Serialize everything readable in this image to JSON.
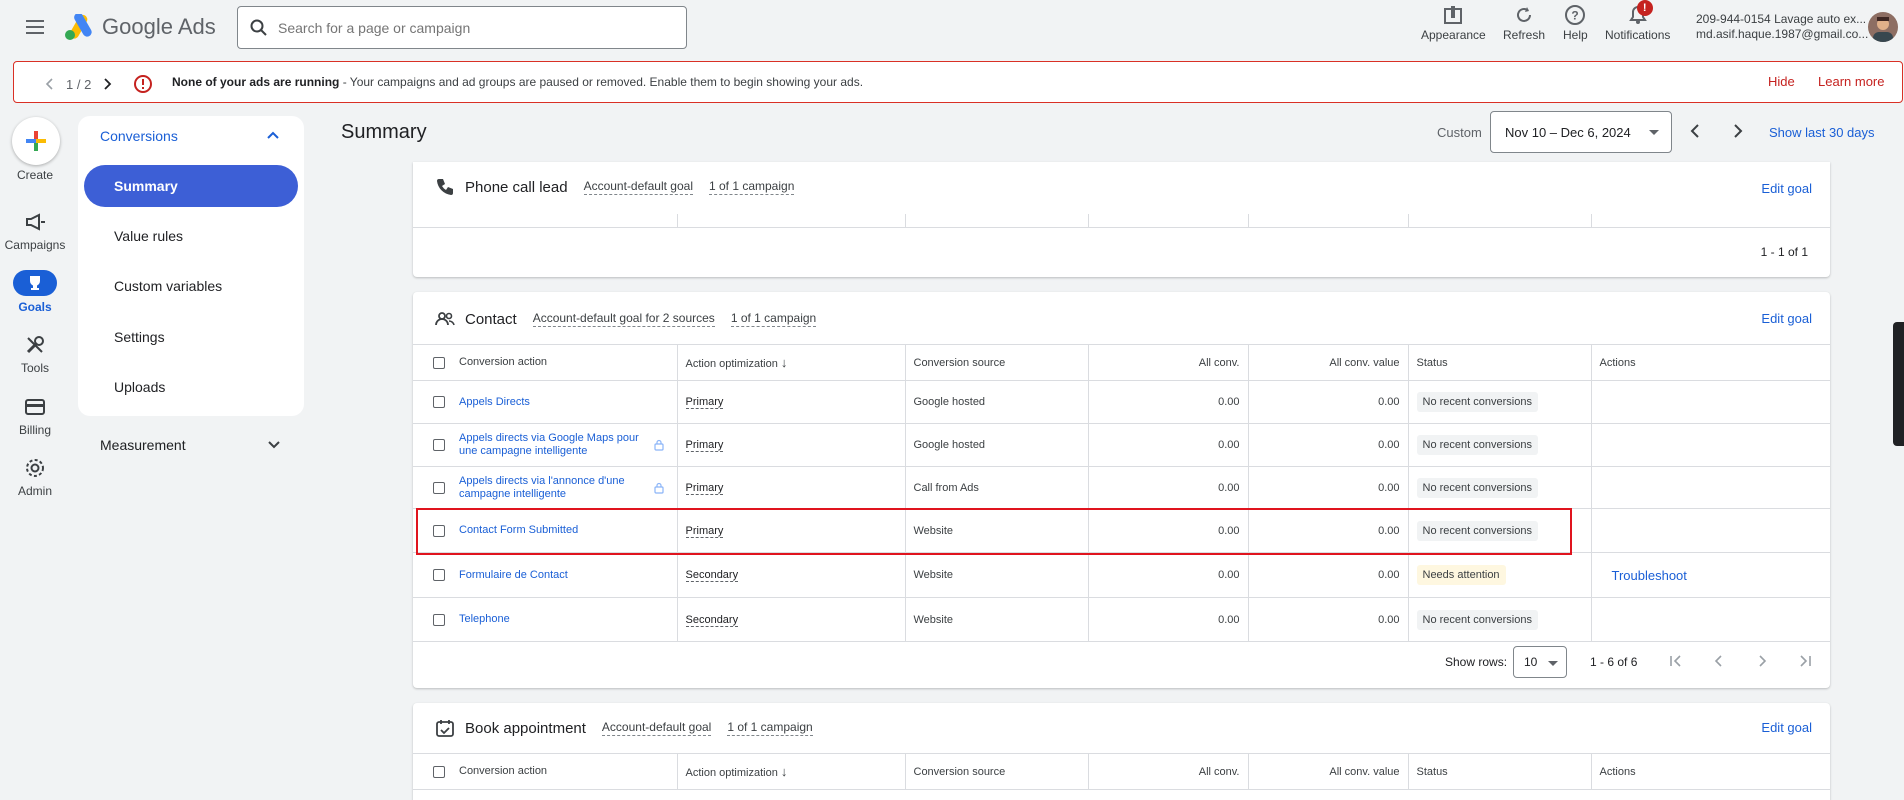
{
  "app": {
    "name": "Google Ads"
  },
  "search": {
    "placeholder": "Search for a page or campaign"
  },
  "topbar": {
    "appearance": "Appearance",
    "refresh": "Refresh",
    "help": "Help",
    "notifications": "Notifications",
    "notification_count": "!",
    "account_line1": "209-944-0154 Lavage auto ex...",
    "account_line2": "md.asif.haque.1987@gmail.co..."
  },
  "alert": {
    "pager": "1 / 2",
    "bold": "None of your ads are running",
    "text": " - Your campaigns and ad groups are paused or removed. Enable them to begin showing your ads.",
    "hide": "Hide",
    "learn_more": "Learn more"
  },
  "rail": {
    "create": "Create",
    "campaigns": "Campaigns",
    "goals": "Goals",
    "tools": "Tools",
    "billing": "Billing",
    "admin": "Admin"
  },
  "sidenav": {
    "section": "Conversions",
    "items": [
      "Summary",
      "Value rules",
      "Custom variables",
      "Settings",
      "Uploads"
    ],
    "measurement": "Measurement"
  },
  "header": {
    "title": "Summary",
    "custom": "Custom",
    "date_range": "Nov 10 – Dec 6, 2024",
    "show_last": "Show last 30 days"
  },
  "phone_card": {
    "title": "Phone call lead",
    "goal": "Account-default goal",
    "campaigns": "1 of 1 campaign",
    "edit": "Edit goal",
    "count": "1 - 1 of 1"
  },
  "contact_card": {
    "title": "Contact",
    "goal": "Account-default goal for 2 sources",
    "campaigns": "1 of 1 campaign",
    "edit": "Edit goal",
    "columns": [
      "Conversion action",
      "Action optimization",
      "Conversion source",
      "All conv.",
      "All conv. value",
      "Status",
      "Actions"
    ],
    "rows": [
      {
        "name": "Appels Directs",
        "opt": "Primary",
        "source": "Google hosted",
        "conv": "0.00",
        "value": "0.00",
        "status": "No recent conversions",
        "action": ""
      },
      {
        "name": "Appels directs via Google Maps pour une campagne intelligente",
        "opt": "Primary",
        "source": "Google hosted",
        "conv": "0.00",
        "value": "0.00",
        "status": "No recent conversions",
        "action": ""
      },
      {
        "name": "Appels directs via l'annonce d'une campagne intelligente",
        "opt": "Primary",
        "source": "Call from Ads",
        "conv": "0.00",
        "value": "0.00",
        "status": "No recent conversions",
        "action": ""
      },
      {
        "name": "Contact Form Submitted",
        "opt": "Primary",
        "source": "Website",
        "conv": "0.00",
        "value": "0.00",
        "status": "No recent conversions",
        "action": ""
      },
      {
        "name": "Formulaire de Contact",
        "opt": "Secondary",
        "source": "Website",
        "conv": "0.00",
        "value": "0.00",
        "status": "Needs attention",
        "action": "Troubleshoot"
      },
      {
        "name": "Telephone",
        "opt": "Secondary",
        "source": "Website",
        "conv": "0.00",
        "value": "0.00",
        "status": "No recent conversions",
        "action": ""
      }
    ],
    "show_rows_label": "Show rows:",
    "show_rows_value": "10",
    "count": "1 - 6 of 6"
  },
  "book_card": {
    "title": "Book appointment",
    "goal": "Account-default goal",
    "campaigns": "1 of 1 campaign",
    "edit": "Edit goal",
    "columns": [
      "Conversion action",
      "Action optimization",
      "Conversion source",
      "All conv.",
      "All conv. value",
      "Status",
      "Actions"
    ]
  },
  "colors": {
    "accent": "#1a5fd6",
    "alert": "#d93025",
    "highlight": "#e0141e"
  }
}
